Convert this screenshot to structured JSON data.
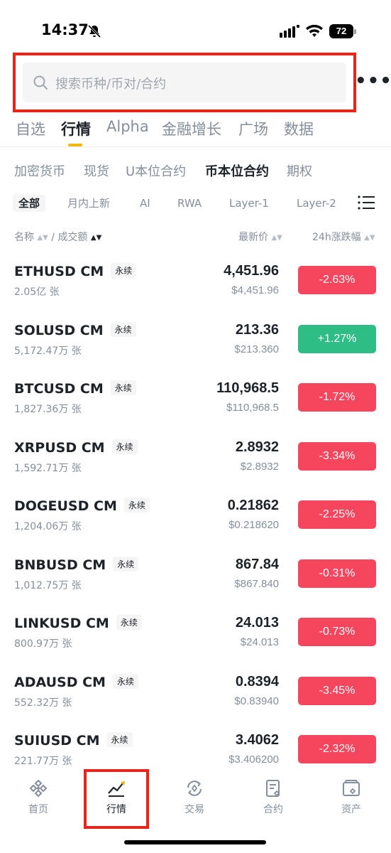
{
  "status_bar": {
    "time": "14:37",
    "battery": "72"
  },
  "search": {
    "placeholder": "搜索币种/币对/合约"
  },
  "top_tabs": [
    {
      "label": "自选",
      "active": false
    },
    {
      "label": "行情",
      "active": true
    },
    {
      "label": "Alpha",
      "active": false
    },
    {
      "label": "金融增长",
      "active": false
    },
    {
      "label": "广场",
      "active": false
    },
    {
      "label": "数据",
      "active": false
    }
  ],
  "sub_tabs": [
    {
      "label": "加密货币",
      "active": false
    },
    {
      "label": "现货",
      "active": false
    },
    {
      "label": "U本位合约",
      "active": false
    },
    {
      "label": "币本位合约",
      "active": true
    },
    {
      "label": "期权",
      "active": false
    }
  ],
  "chips": [
    {
      "label": "全部",
      "active": true
    },
    {
      "label": "月内上新",
      "active": false
    },
    {
      "label": "AI",
      "active": false
    },
    {
      "label": "RWA",
      "active": false
    },
    {
      "label": "Layer-1",
      "active": false
    },
    {
      "label": "Layer-2",
      "active": false
    }
  ],
  "columns": {
    "name": "名称",
    "volume": "成交额",
    "price": "最新价",
    "change": "24h涨跌幅"
  },
  "perp_badge": "永续",
  "rows": [
    {
      "symbol": "ETHUSD CM",
      "volume": "2.05亿 张",
      "price": "4,451.96",
      "usd": "$4,451.96",
      "change": "-2.63%",
      "direction": "down"
    },
    {
      "symbol": "SOLUSD CM",
      "volume": "5,172.47万 张",
      "price": "213.36",
      "usd": "$213.360",
      "change": "+1.27%",
      "direction": "up"
    },
    {
      "symbol": "BTCUSD CM",
      "volume": "1,827.36万 张",
      "price": "110,968.5",
      "usd": "$110,968.5",
      "change": "-1.72%",
      "direction": "down"
    },
    {
      "symbol": "XRPUSD CM",
      "volume": "1,592.71万 张",
      "price": "2.8932",
      "usd": "$2.8932",
      "change": "-3.34%",
      "direction": "down"
    },
    {
      "symbol": "DOGEUSD CM",
      "volume": "1,204.06万 张",
      "price": "0.21862",
      "usd": "$0.218620",
      "change": "-2.25%",
      "direction": "down"
    },
    {
      "symbol": "BNBUSD CM",
      "volume": "1,012.75万 张",
      "price": "867.84",
      "usd": "$867.840",
      "change": "-0.31%",
      "direction": "down"
    },
    {
      "symbol": "LINKUSD CM",
      "volume": "800.97万 张",
      "price": "24.013",
      "usd": "$24.013",
      "change": "-0.73%",
      "direction": "down"
    },
    {
      "symbol": "ADAUSD CM",
      "volume": "552.32万 张",
      "price": "0.8394",
      "usd": "$0.83940",
      "change": "-3.45%",
      "direction": "down"
    },
    {
      "symbol": "SUIUSD CM",
      "volume": "221.77万 张",
      "price": "3.4062",
      "usd": "$3.406200",
      "change": "-2.32%",
      "direction": "down"
    }
  ],
  "colors": {
    "up": "#2ebd85",
    "down": "#f6465d",
    "accent": "#f0b90b",
    "annotation": "#e8251b"
  },
  "bottom_nav": [
    {
      "label": "首页",
      "icon": "home-icon",
      "active": false
    },
    {
      "label": "行情",
      "icon": "markets-icon",
      "active": true
    },
    {
      "label": "交易",
      "icon": "trade-icon",
      "active": false
    },
    {
      "label": "合约",
      "icon": "futures-icon",
      "active": false
    },
    {
      "label": "资产",
      "icon": "wallet-icon",
      "active": false
    }
  ]
}
